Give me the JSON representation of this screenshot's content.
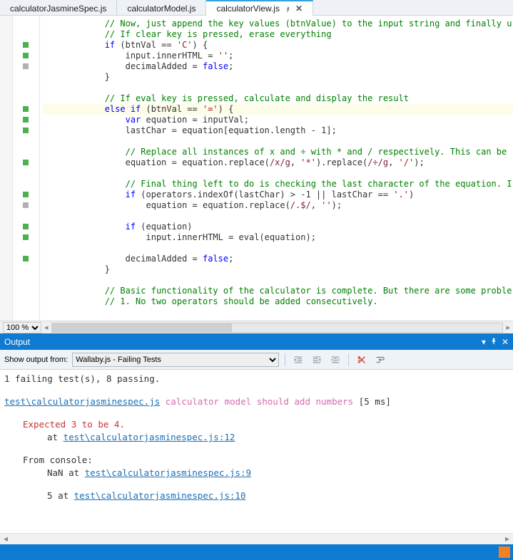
{
  "tabs": [
    {
      "label": "calculatorJasmineSpec.js",
      "active": false,
      "pinned": false,
      "closeable": false
    },
    {
      "label": "calculatorModel.js",
      "active": false,
      "pinned": false,
      "closeable": false
    },
    {
      "label": "calculatorView.js",
      "active": true,
      "pinned": true,
      "closeable": true
    }
  ],
  "zoom": {
    "value": "100 %"
  },
  "code": {
    "lines": [
      {
        "m": "",
        "seg": [
          [
            "c",
            "// Now, just append the key values (btnValue) to the input string and finally u"
          ]
        ]
      },
      {
        "m": "",
        "seg": [
          [
            "c",
            "// If clear key is pressed, erase everything"
          ]
        ]
      },
      {
        "m": "green",
        "seg": [
          [
            "k",
            "if"
          ],
          [
            "p",
            " (btnVal == "
          ],
          [
            "s",
            "'C'"
          ],
          [
            "p",
            ") {"
          ]
        ]
      },
      {
        "m": "green",
        "seg": [
          [
            "p",
            "    input.innerHTML = "
          ],
          [
            "s",
            "''"
          ],
          [
            "p",
            ";"
          ]
        ]
      },
      {
        "m": "gray",
        "seg": [
          [
            "p",
            "    decimalAdded = "
          ],
          [
            "k",
            "false"
          ],
          [
            "p",
            ";"
          ]
        ]
      },
      {
        "m": "",
        "seg": [
          [
            "p",
            "}"
          ]
        ]
      },
      {
        "m": "",
        "seg": [
          [
            "p",
            ""
          ]
        ]
      },
      {
        "m": "",
        "seg": [
          [
            "c",
            "// If eval key is pressed, calculate and display the result"
          ]
        ]
      },
      {
        "m": "green",
        "hl": true,
        "seg": [
          [
            "k",
            "else if"
          ],
          [
            "p",
            " (btnVal == "
          ],
          [
            "s",
            "'='"
          ],
          [
            "p",
            ") {"
          ]
        ]
      },
      {
        "m": "green",
        "seg": [
          [
            "p",
            "    "
          ],
          [
            "k",
            "var"
          ],
          [
            "p",
            " equation = inputVal;"
          ]
        ]
      },
      {
        "m": "green",
        "seg": [
          [
            "p",
            "    lastChar = equation[equation.length - 1];"
          ]
        ]
      },
      {
        "m": "",
        "seg": [
          [
            "p",
            ""
          ]
        ]
      },
      {
        "m": "",
        "seg": [
          [
            "p",
            "    "
          ],
          [
            "c",
            "// Replace all instances of x and ÷ with * and / respectively. This can be"
          ]
        ]
      },
      {
        "m": "green",
        "seg": [
          [
            "p",
            "    equation = equation.replace("
          ],
          [
            "r",
            "/x/g"
          ],
          [
            "p",
            ", "
          ],
          [
            "s",
            "'*'"
          ],
          [
            "p",
            ").replace("
          ],
          [
            "r",
            "/÷/g"
          ],
          [
            "p",
            ", "
          ],
          [
            "s",
            "'/'"
          ],
          [
            "p",
            ");"
          ]
        ]
      },
      {
        "m": "",
        "seg": [
          [
            "p",
            ""
          ]
        ]
      },
      {
        "m": "",
        "seg": [
          [
            "p",
            "    "
          ],
          [
            "c",
            "// Final thing left to do is checking the last character of the equation. I"
          ]
        ]
      },
      {
        "m": "green",
        "seg": [
          [
            "p",
            "    "
          ],
          [
            "k",
            "if"
          ],
          [
            "p",
            " (operators.indexOf(lastChar) > -1 || lastChar == "
          ],
          [
            "s",
            "'.'"
          ],
          [
            "p",
            ")"
          ]
        ]
      },
      {
        "m": "gray",
        "seg": [
          [
            "p",
            "        equation = equation.replace("
          ],
          [
            "r",
            "/.$/"
          ],
          [
            "p",
            ", "
          ],
          [
            "s",
            "''"
          ],
          [
            "p",
            ");"
          ]
        ]
      },
      {
        "m": "",
        "seg": [
          [
            "p",
            ""
          ]
        ]
      },
      {
        "m": "green",
        "seg": [
          [
            "p",
            "    "
          ],
          [
            "k",
            "if"
          ],
          [
            "p",
            " (equation)"
          ]
        ]
      },
      {
        "m": "green",
        "seg": [
          [
            "p",
            "        input.innerHTML = eval(equation);"
          ]
        ]
      },
      {
        "m": "",
        "seg": [
          [
            "p",
            ""
          ]
        ]
      },
      {
        "m": "green",
        "seg": [
          [
            "p",
            "    decimalAdded = "
          ],
          [
            "k",
            "false"
          ],
          [
            "p",
            ";"
          ]
        ]
      },
      {
        "m": "",
        "seg": [
          [
            "p",
            "}"
          ]
        ]
      },
      {
        "m": "",
        "seg": [
          [
            "p",
            ""
          ]
        ]
      },
      {
        "m": "",
        "seg": [
          [
            "c",
            "// Basic functionality of the calculator is complete. But there are some proble"
          ]
        ]
      },
      {
        "m": "",
        "seg": [
          [
            "c",
            "// 1. No two operators should be added consecutively."
          ]
        ]
      }
    ],
    "indent": "            "
  },
  "output_panel": {
    "title": "Output",
    "toolbar": {
      "label": "Show output from:",
      "selected": "Wallaby.js - Failing Tests"
    },
    "summary": "1 failing test(s), 8 passing.",
    "test": {
      "file": "test\\calculatorjasminespec.js",
      "desc": "calculator model should add numbers",
      "time": "[5 ms]"
    },
    "expect_line": "Expected 3 to be 4.",
    "at_label": "at",
    "at_link": "test\\calculatorjasminespec.js:12",
    "console_label": "From console:",
    "console": [
      {
        "msg": "NaN",
        "at": "at",
        "link": "test\\calculatorjasminespec.js:9"
      },
      {
        "msg": "5",
        "at": "at",
        "link": "test\\calculatorjasminespec.js:10"
      }
    ]
  }
}
